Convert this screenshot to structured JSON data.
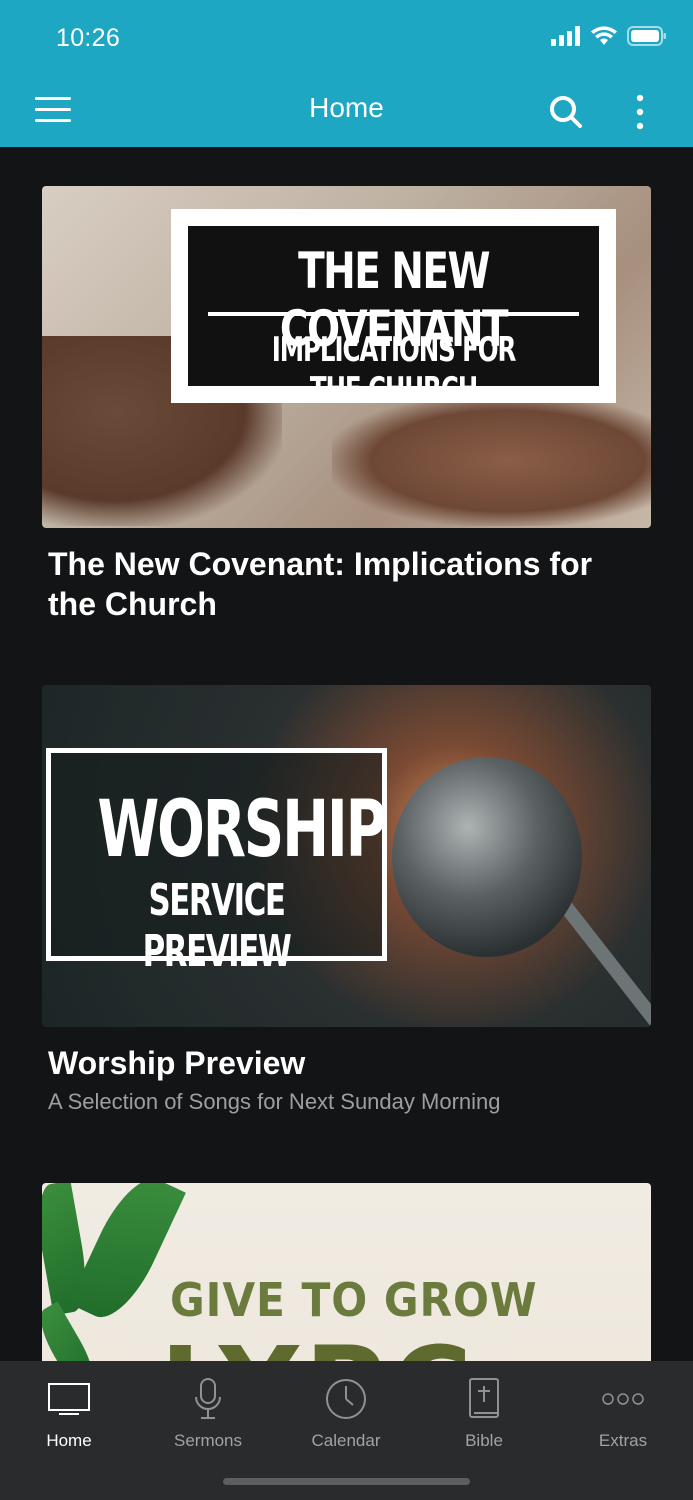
{
  "status_bar": {
    "time": "10:26"
  },
  "nav": {
    "title": "Home"
  },
  "cards": [
    {
      "image": {
        "headline": "THE NEW COVENANT",
        "subheadline": "IMPLICATIONS FOR THE CHURCH"
      },
      "title": "The New Covenant: Implications for the Church",
      "subtitle": ""
    },
    {
      "image": {
        "headline": "WORSHIP",
        "subheadline": "SERVICE PREVIEW"
      },
      "title": "Worship Preview",
      "subtitle": "A Selection of Songs for Next Sunday Morning"
    },
    {
      "image": {
        "headline": "GIVE TO GROW",
        "subheadline": "LYPC"
      },
      "title": "",
      "subtitle": ""
    }
  ],
  "tabs": [
    {
      "label": "Home",
      "icon": "tv-icon",
      "active": true
    },
    {
      "label": "Sermons",
      "icon": "microphone-icon",
      "active": false
    },
    {
      "label": "Calendar",
      "icon": "clock-icon",
      "active": false
    },
    {
      "label": "Bible",
      "icon": "bible-icon",
      "active": false
    },
    {
      "label": "Extras",
      "icon": "more-dots-icon",
      "active": false
    }
  ],
  "colors": {
    "accent": "#1ea7c3",
    "background": "#131416",
    "tabbar": "#2a2b2d"
  }
}
